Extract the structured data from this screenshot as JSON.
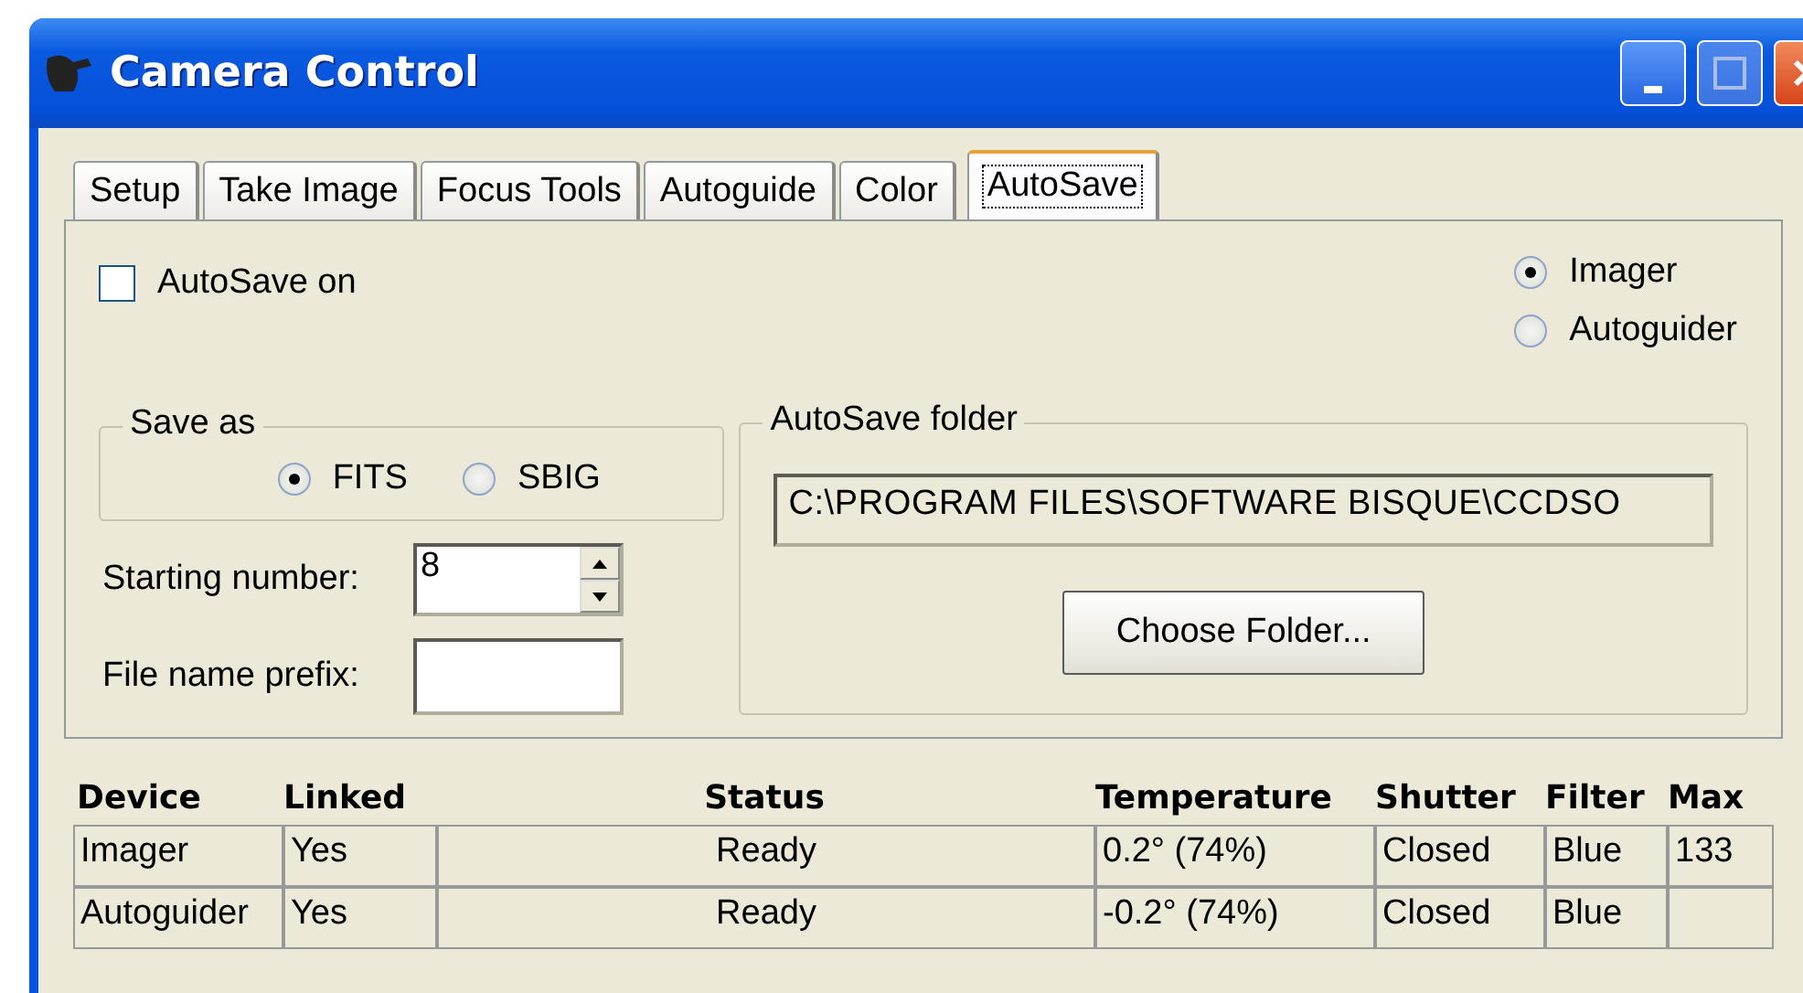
{
  "window": {
    "title": "Camera Control"
  },
  "tabs": [
    {
      "label": "Setup",
      "selected": false
    },
    {
      "label": "Take Image",
      "selected": false
    },
    {
      "label": "Focus Tools",
      "selected": false
    },
    {
      "label": "Autoguide",
      "selected": false
    },
    {
      "label": "Color",
      "selected": false
    },
    {
      "label": "AutoSave",
      "selected": true
    }
  ],
  "autosave": {
    "label": "AutoSave on",
    "checked": false
  },
  "device_options": [
    {
      "label": "Imager",
      "selected": true
    },
    {
      "label": "Autoguider",
      "selected": false
    }
  ],
  "save_as": {
    "title": "Save as",
    "options": [
      {
        "label": "FITS",
        "selected": true
      },
      {
        "label": "SBIG",
        "selected": false
      }
    ]
  },
  "starting_number": {
    "label": "Starting number:",
    "value": "8"
  },
  "file_name_prefix": {
    "label": "File name prefix:"
  },
  "folder": {
    "title": "AutoSave folder",
    "path": "C:\\PROGRAM FILES\\SOFTWARE BISQUE\\CCDSO",
    "button": "Choose Folder..."
  },
  "table": {
    "columns": [
      "Device",
      "Linked",
      "Status",
      "Temperature",
      "Shutter",
      "Filter",
      "Max"
    ],
    "rows": [
      [
        "Imager",
        "Yes",
        "Ready",
        "0.2° (74%)",
        "Closed",
        "Blue",
        "133"
      ],
      [
        "Autoguider",
        "Yes",
        "Ready",
        "-0.2° (74%)",
        "Closed",
        "Blue"
      ]
    ]
  }
}
